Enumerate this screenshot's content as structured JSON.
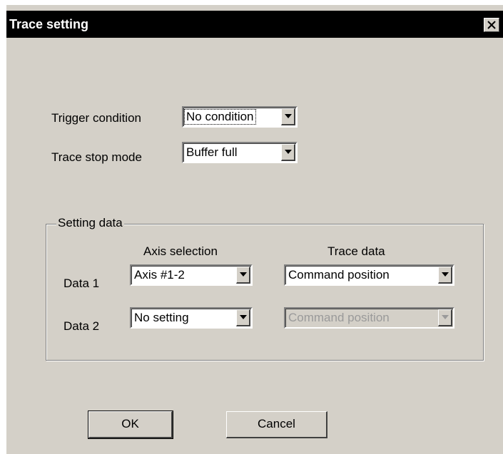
{
  "dialog": {
    "title": "Trace setting"
  },
  "form": {
    "trigger_condition_label": "Trigger condition",
    "trigger_condition_value": "No condition",
    "trace_stop_mode_label": "Trace stop mode",
    "trace_stop_mode_value": "Buffer full"
  },
  "setting_data": {
    "group_title": "Setting data",
    "axis_selection_header": "Axis selection",
    "trace_data_header": "Trace data",
    "rows": [
      {
        "label": "Data 1",
        "axis": "Axis #1-2",
        "trace": "Command position",
        "trace_enabled": true
      },
      {
        "label": "Data 2",
        "axis": "No setting",
        "trace": "Command position",
        "trace_enabled": false
      }
    ]
  },
  "buttons": {
    "ok": "OK",
    "cancel": "Cancel"
  },
  "colors": {
    "face": "#d4d0c8",
    "titlebar": "#000000",
    "disabled_text": "#9a9a9a"
  },
  "icons": {
    "close": "close-icon",
    "dropdown": "chevron-down-icon"
  }
}
